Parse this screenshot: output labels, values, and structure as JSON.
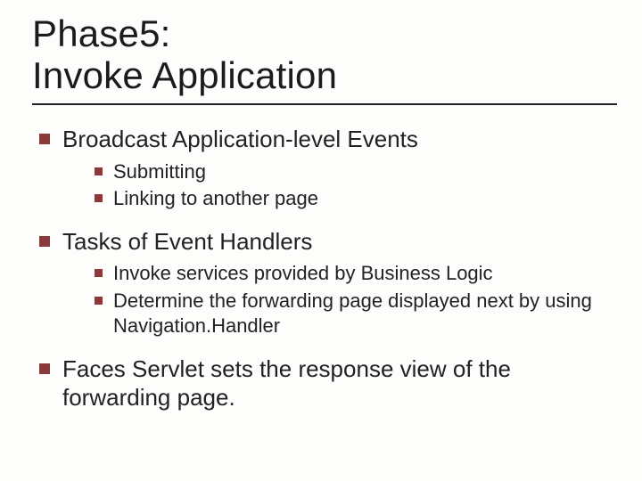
{
  "title_line1": "Phase5:",
  "title_line2": "Invoke Application",
  "items": [
    {
      "text": "Broadcast Application-level Events",
      "sub": [
        "Submitting",
        "Linking to another page"
      ]
    },
    {
      "text": "Tasks of Event Handlers",
      "sub": [
        "Invoke services provided by Business Logic",
        "Determine the forwarding page displayed next by using Navigation.Handler"
      ]
    },
    {
      "text": "Faces Servlet sets the response view of the forwarding page.",
      "sub": []
    }
  ]
}
